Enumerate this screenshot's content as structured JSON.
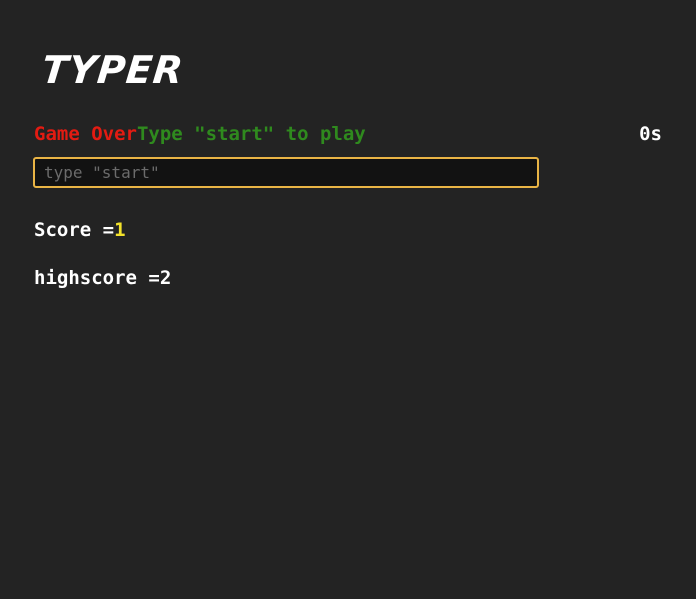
{
  "game": {
    "title": "TYPER",
    "status": "Game Over",
    "instruction": "Type \"start\" to play",
    "timer": "0s"
  },
  "input": {
    "placeholder": "type \"start\"",
    "value": ""
  },
  "score": {
    "label": "Score =",
    "value": "1"
  },
  "highscore": {
    "label": "highscore =",
    "value": "2"
  },
  "colors": {
    "background": "#232323",
    "game_over": "#e31b12",
    "instruction": "#2f8a1e",
    "input_border": "#e9b445",
    "score_value": "#f2e12a"
  }
}
